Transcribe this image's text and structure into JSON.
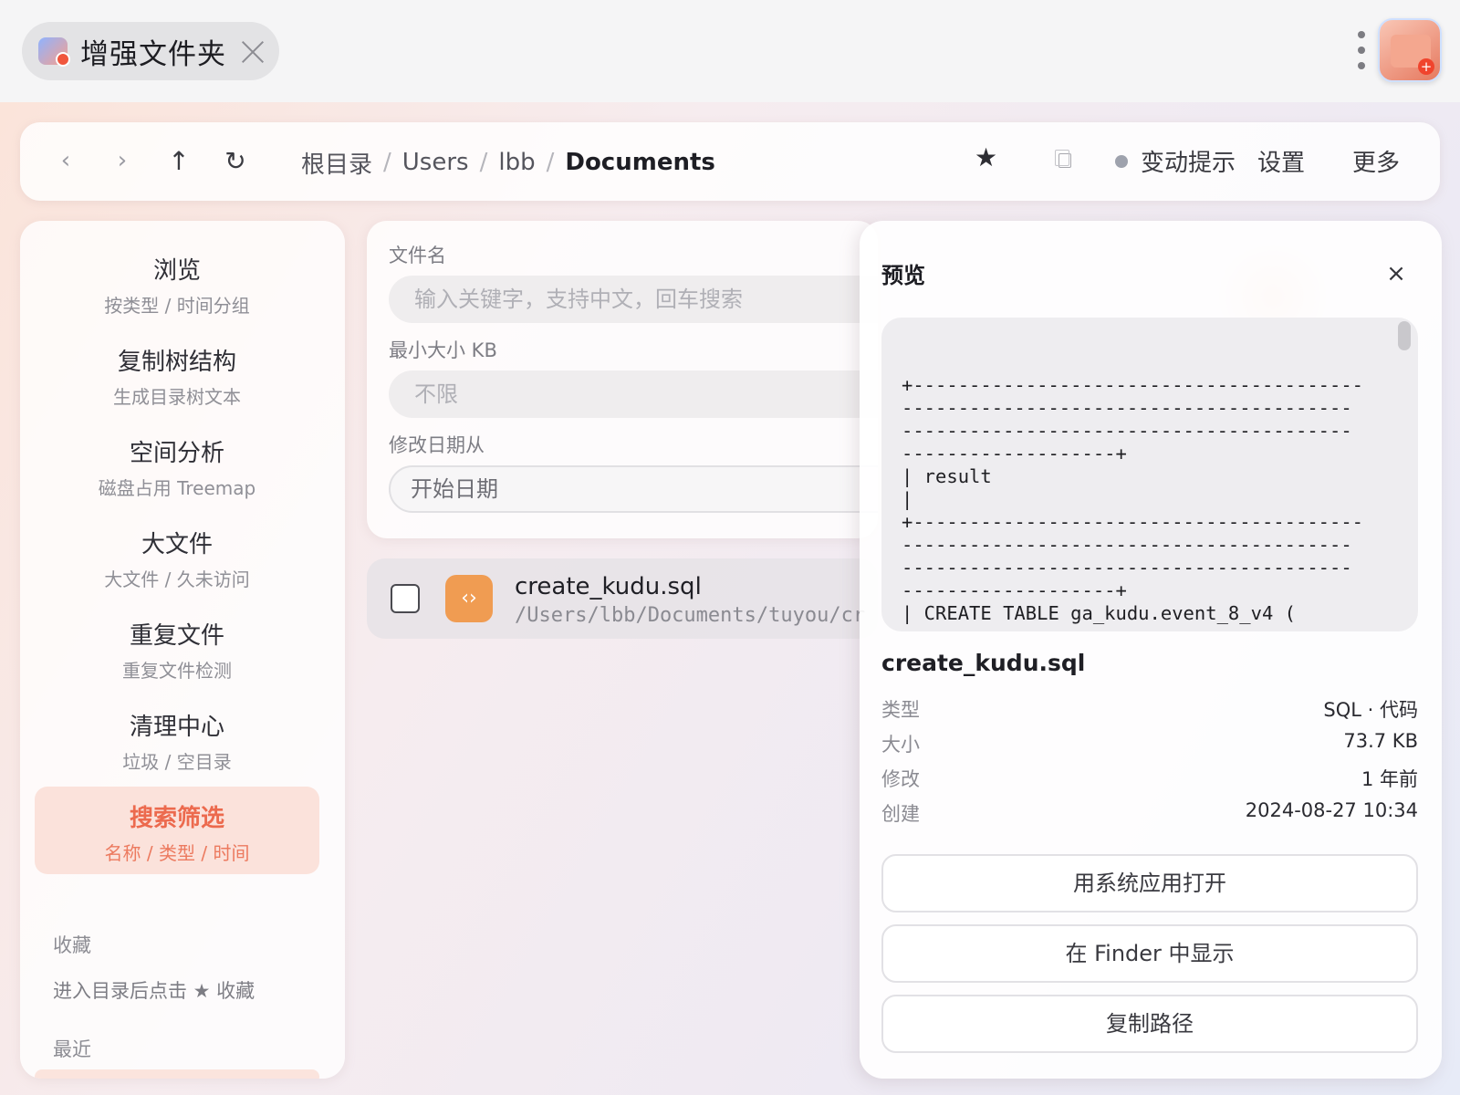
{
  "titlebar": {
    "app_title": "增强文件夹"
  },
  "toolbar": {
    "back": "‹",
    "forward": "›",
    "up": "↑",
    "refresh": "↻",
    "breadcrumb": [
      "根目录",
      "Users",
      "lbb",
      "Documents"
    ],
    "separator": "/",
    "star": "★",
    "watch_label": "变动提示",
    "settings_label": "设置",
    "more_label": "更多"
  },
  "sidebar": {
    "items": [
      {
        "label": "浏览",
        "sub": "按类型 / 时间分组"
      },
      {
        "label": "复制树结构",
        "sub": "生成目录树文本"
      },
      {
        "label": "空间分析",
        "sub": "磁盘占用 Treemap"
      },
      {
        "label": "大文件",
        "sub": "大文件 / 久未访问"
      },
      {
        "label": "重复文件",
        "sub": "重复文件检测"
      },
      {
        "label": "清理中心",
        "sub": "垃圾 / 空目录"
      },
      {
        "label": "搜索筛选",
        "sub": "名称 / 类型 / 时间",
        "active": true
      }
    ],
    "favorites_title": "收藏",
    "favorites_hint": "进入目录后点击 ★ 收藏",
    "recent_title": "最近"
  },
  "filters": {
    "name_label": "文件名",
    "name_placeholder": "输入关键字，支持中文，回车搜索",
    "min_size_label": "最小大小 KB",
    "min_size_placeholder": "不限",
    "date_from_label": "修改日期从",
    "date_from_placeholder": "开始日期"
  },
  "results": [
    {
      "name": "create_kudu.sql",
      "path": "/Users/lbb/Documents/tuyou/cr",
      "icon": "‹›"
    }
  ],
  "preview": {
    "title": "预览",
    "close": "×",
    "code": "+----------------------------------------\n----------------------------------------\n----------------------------------------\n-------------------+\n| result\n|\n+----------------------------------------\n----------------------------------------\n----------------------------------------\n-------------------+\n| CREATE TABLE ga_kudu.event_8_v4 (",
    "file_name": "create_kudu.sql",
    "meta": [
      {
        "key": "类型",
        "value": "SQL · 代码"
      },
      {
        "key": "大小",
        "value": "73.7 KB"
      },
      {
        "key": "修改",
        "value": "1 年前"
      },
      {
        "key": "创建",
        "value": "2024-08-27 10:34"
      }
    ],
    "open_label": "用系统应用打开",
    "finder_label": "在 Finder 中显示",
    "copy_path_label": "复制路径"
  }
}
